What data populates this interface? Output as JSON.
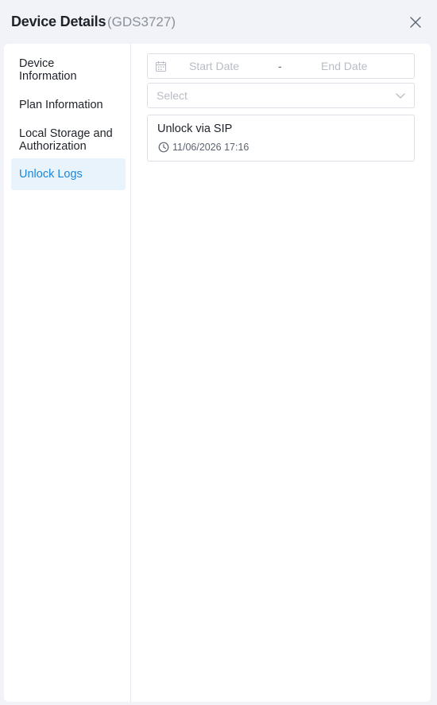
{
  "header": {
    "title": "Device Details",
    "subtitle": "(GDS3727)"
  },
  "sidebar": {
    "items": [
      {
        "label": "Device\nInformation",
        "active": false
      },
      {
        "label": "Plan Information",
        "active": false
      },
      {
        "label": "Local Storage and\nAuthorization",
        "active": false
      },
      {
        "label": "Unlock Logs",
        "active": true
      }
    ]
  },
  "filters": {
    "start_date_placeholder": "Start Date",
    "separator": "-",
    "end_date_placeholder": "End Date",
    "select_placeholder": "Select"
  },
  "logs": [
    {
      "title": "Unlock via SIP",
      "time": "11/06/2026 17:16"
    }
  ],
  "colors": {
    "accent": "#1e86d8",
    "active_bg": "#e9f3fc",
    "page_bg": "#f1f3f8",
    "border": "#dcdfe6"
  },
  "icons": {
    "close": "close-icon",
    "calendar": "calendar-icon",
    "chevron": "chevron-down-icon",
    "clock": "clock-icon"
  }
}
